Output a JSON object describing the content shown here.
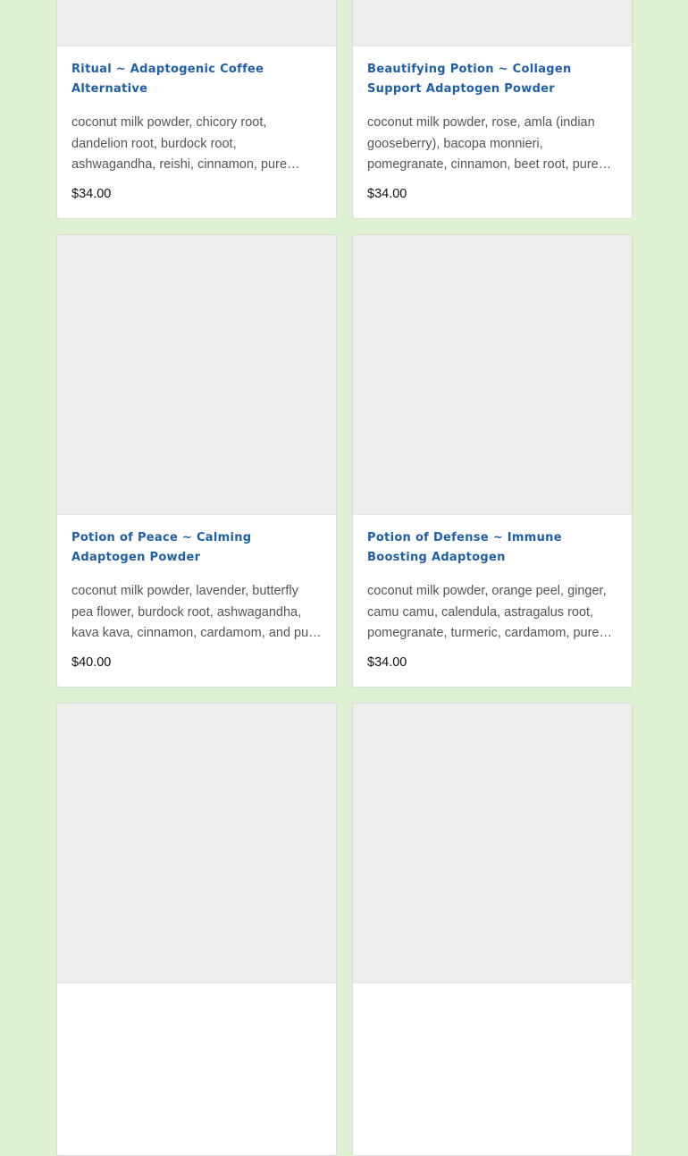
{
  "products": [
    {
      "title": "Ritual ~ Adaptogenic Coffee Alternative",
      "description": "coconut milk powder, chicory root, dandelion root, burdock root, ashwagandha, reishi, cinnamon, pure monk fruit",
      "price": "$34.00"
    },
    {
      "title": "Beautifying Potion ~ Collagen Support Adaptogen Powder",
      "description": "coconut milk powder, rose, amla (indian gooseberry), bacopa monnieri, pomegranate, cinnamon, beet root, pure monk fruit",
      "price": "$34.00"
    },
    {
      "title": "Potion of Peace ~ Calming Adaptogen Powder",
      "description": "coconut milk powder, lavender, butterfly pea flower, burdock root, ashwagandha, kava kava, cinnamon, cardamom, and pure monk fruit",
      "price": "$40.00"
    },
    {
      "title": "Potion of Defense ~ Immune Boosting Adaptogen",
      "description": "coconut milk powder, orange peel, ginger, camu camu, calendula, astragalus root, pomegranate, turmeric, cardamom, pure monk fruit",
      "price": "$34.00"
    },
    {
      "title": "",
      "description": "",
      "price": ""
    },
    {
      "title": "",
      "description": "",
      "price": ""
    }
  ]
}
